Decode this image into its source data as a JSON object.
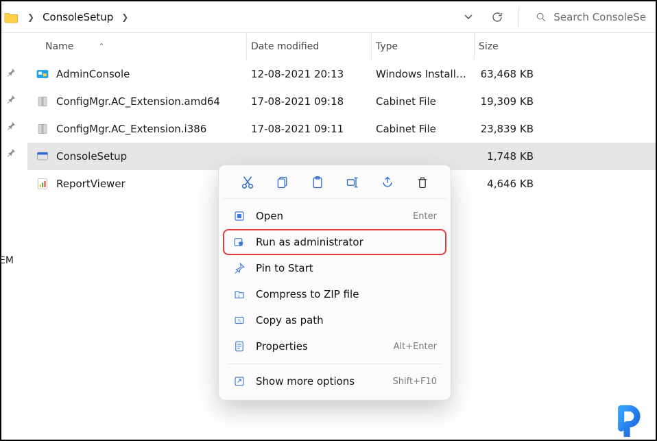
{
  "addressbar": {
    "folder_name": "ConsoleSetup",
    "search_placeholder": "Search ConsoleSe"
  },
  "columns": {
    "name": "Name",
    "date": "Date modified",
    "type": "Type",
    "size": "Size"
  },
  "sidebar_fragment": "EM",
  "files": [
    {
      "icon": "msi",
      "name": "AdminConsole",
      "date": "12-08-2021 20:13",
      "type": "Windows Installer ...",
      "size": "63,468 KB"
    },
    {
      "icon": "cab",
      "name": "ConfigMgr.AC_Extension.amd64",
      "date": "17-08-2021 09:18",
      "type": "Cabinet File",
      "size": "19,309 KB"
    },
    {
      "icon": "cab",
      "name": "ConfigMgr.AC_Extension.i386",
      "date": "17-08-2021 09:11",
      "type": "Cabinet File",
      "size": "23,839 KB"
    },
    {
      "icon": "exe",
      "name": "ConsoleSetup",
      "date": "",
      "type": "",
      "size": "1,748 KB",
      "selected": true
    },
    {
      "icon": "rpt",
      "name": "ReportViewer",
      "date": "",
      "type": "",
      "size": "4,646 KB"
    }
  ],
  "context_menu": {
    "open": "Open",
    "open_shortcut": "Enter",
    "run_admin": "Run as administrator",
    "pin_start": "Pin to Start",
    "compress": "Compress to ZIP file",
    "copy_path": "Copy as path",
    "properties": "Properties",
    "properties_shortcut": "Alt+Enter",
    "show_more": "Show more options",
    "show_more_shortcut": "Shift+F10"
  },
  "icons": {
    "cut": "cut-icon",
    "copy": "copy-icon",
    "paste": "paste-icon",
    "rename": "rename-icon",
    "share": "share-icon",
    "delete": "delete-icon"
  }
}
